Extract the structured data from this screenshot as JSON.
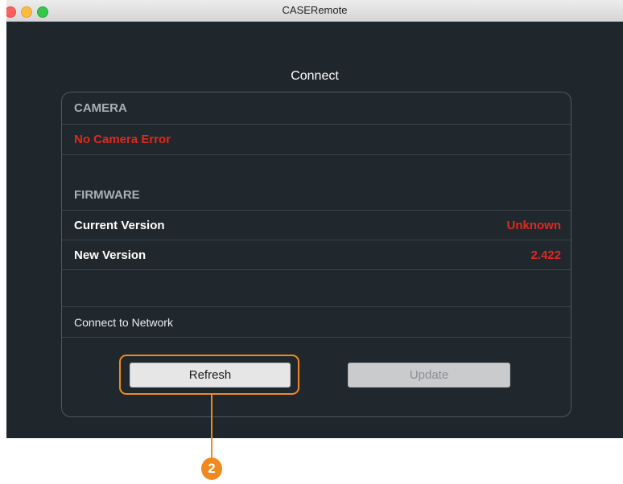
{
  "window": {
    "title": "CASERemote"
  },
  "panel": {
    "heading": "Connect",
    "camera": {
      "section_label": "CAMERA",
      "status": "No Camera Error"
    },
    "firmware": {
      "section_label": "FIRMWARE",
      "current_version_label": "Current Version",
      "current_version_value": "Unknown",
      "new_version_label": "New Version",
      "new_version_value": "2.422"
    },
    "network": {
      "label": "Connect to Network"
    },
    "buttons": {
      "refresh_label": "Refresh",
      "update_label": "Update"
    }
  },
  "annotation": {
    "callout_number": "2"
  },
  "colors": {
    "background": "#1f272d",
    "error_red": "#e0281e",
    "callout_orange": "#f08a1f"
  }
}
